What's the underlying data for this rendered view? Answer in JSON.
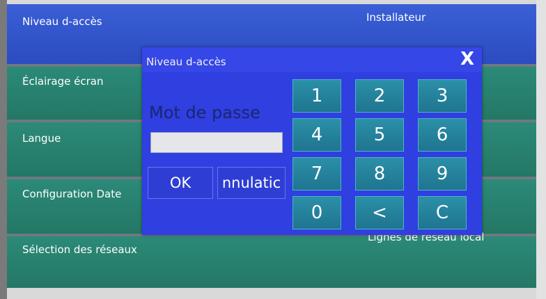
{
  "settings": {
    "access_level": {
      "label": "Niveau d-accès",
      "value": "Installateur"
    },
    "screen_lighting": {
      "label": "Éclairage écran"
    },
    "language": {
      "label": "Langue"
    },
    "date_config": {
      "label": "Configuration Date"
    },
    "network_select": {
      "label": "Sélection des réseaux",
      "value": "Lignes de réseau local"
    }
  },
  "dialog": {
    "title": "Niveau d-accès",
    "close_label": "X",
    "password_label": "Mot de passe",
    "password_value": "",
    "ok_label": "OK",
    "cancel_label": "nnulatic",
    "keys": [
      "1",
      "2",
      "3",
      "4",
      "5",
      "6",
      "7",
      "8",
      "9",
      "0",
      "<",
      "C"
    ]
  },
  "colors": {
    "access_row": "#2b4cc0",
    "setting_row": "#247765",
    "dialog_bg": "#2f3fe0",
    "keypad_key": "#1f7590"
  }
}
